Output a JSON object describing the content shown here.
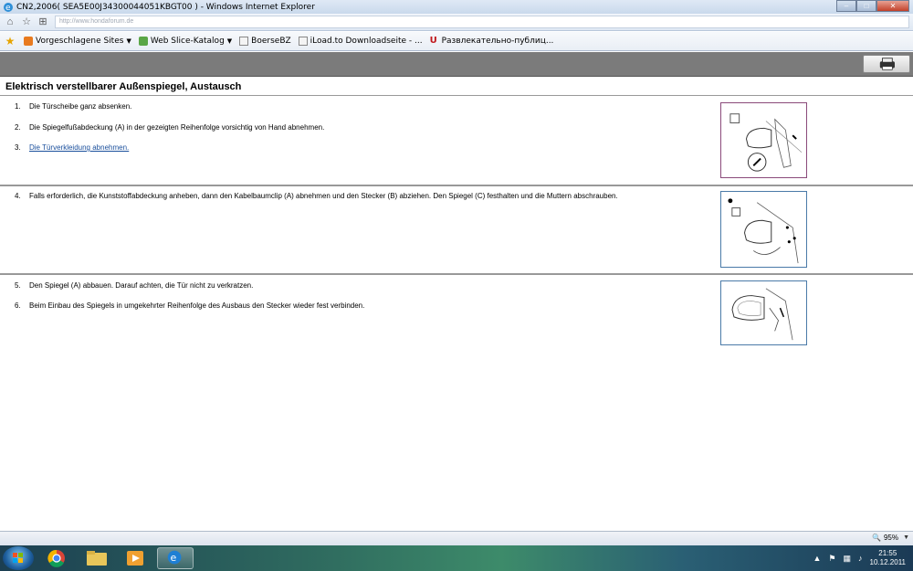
{
  "window": {
    "title": "CN2,2006( SEA5E00J34300044051KBGT00 ) - Windows Internet Explorer",
    "address_faded": "http://www.hondaforum.de"
  },
  "favorites": {
    "items": [
      {
        "label": "Vorgeschlagene Sites",
        "has_menu": true
      },
      {
        "label": "Web Slice-Katalog",
        "has_menu": true
      },
      {
        "label": "BoerseBZ",
        "has_menu": false
      },
      {
        "label": "iLoad.to Downloadseite - ...",
        "has_menu": false
      },
      {
        "label": "Развлекательно-публиц...",
        "has_menu": false
      }
    ]
  },
  "document": {
    "title": "Elektrisch verstellbarer Außenspiegel, Austausch",
    "sections": [
      {
        "steps": [
          {
            "num": "1.",
            "text": "Die Türscheibe ganz absenken."
          },
          {
            "num": "2.",
            "text": "Die Spiegelfußabdeckung (A) in der gezeigten Reihenfolge vorsichtig von Hand abnehmen."
          },
          {
            "num": "3.",
            "text": "Die Türverkleidung abnehmen.",
            "is_link": true
          }
        ]
      },
      {
        "steps": [
          {
            "num": "4.",
            "text": "Falls erforderlich, die Kunststoffabdeckung anheben, dann den Kabelbaumclip (A) abnehmen und den Stecker (B) abziehen. Den Spiegel (C) festhalten und die Muttern abschrauben."
          }
        ]
      },
      {
        "steps": [
          {
            "num": "5.",
            "text": "Den Spiegel (A) abbauen. Darauf achten, die Tür nicht zu verkratzen."
          },
          {
            "num": "6.",
            "text": "Beim Einbau des Spiegels in umgekehrter Reihenfolge des Ausbaus den Stecker wieder fest verbinden."
          }
        ]
      }
    ]
  },
  "status": {
    "zoom": "95%"
  },
  "taskbar": {
    "time": "21:55",
    "date": "10.12.2011"
  },
  "colors": {
    "link": "#1a4f9c",
    "header_gray": "#7b7b7b",
    "figure_border_purple": "#8a4a7a",
    "figure_border_blue": "#4a7aa8"
  }
}
